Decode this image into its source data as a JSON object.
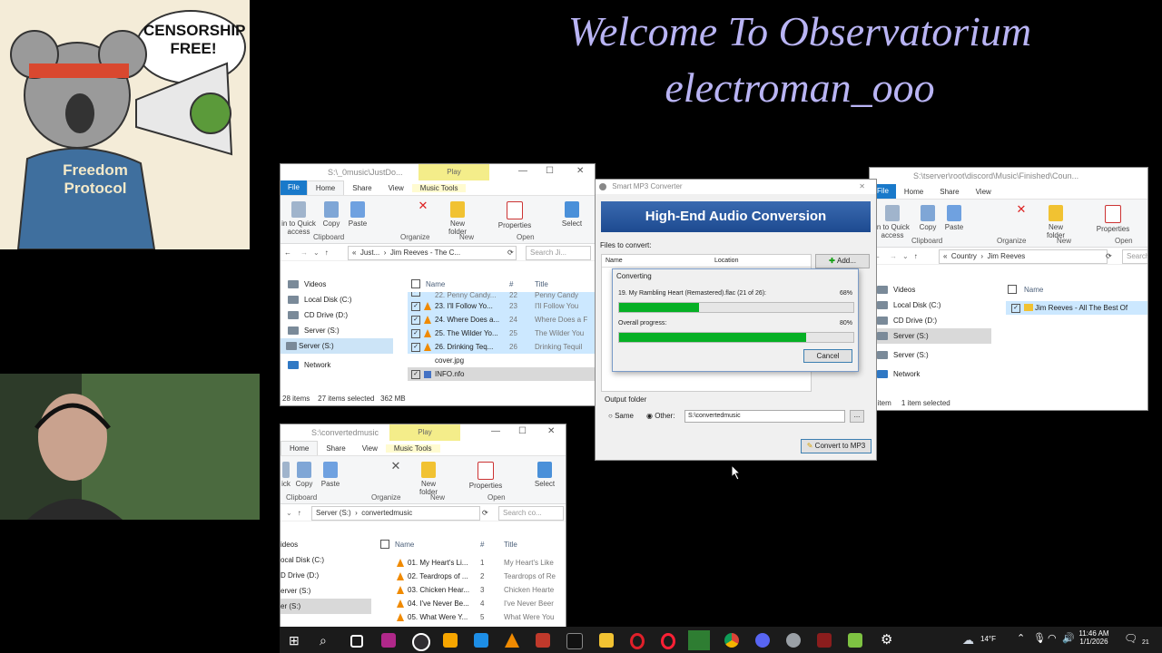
{
  "overlay": {
    "line1": "Welcome To Observatorium",
    "line2": "electroman_ooo"
  },
  "sticker": {
    "top_text": "CENSORSHIP\nFREE!",
    "hoodie_text": "Freedom Protocol"
  },
  "explorer1": {
    "path": "S:\\_0music\\JustDo...",
    "play_tab": "Play",
    "music_tools_tab": "Music Tools",
    "tabs": [
      "File",
      "Home",
      "Share",
      "View"
    ],
    "ribbon": {
      "pin": "in to Quick\naccess",
      "copy": "Copy",
      "paste": "Paste",
      "new_folder": "New\nfolder",
      "properties": "Properties",
      "select": "Select",
      "groups": [
        "Clipboard",
        "Organize",
        "New",
        "Open"
      ]
    },
    "address": [
      "«",
      "Just...",
      "›",
      "Jim Reeves - The C..."
    ],
    "search_placeholder": "Search Ji...",
    "nav": [
      "Videos",
      "Local Disk (C:)",
      "CD Drive (D:)",
      "Server (S:)",
      "Server (S:)",
      "Network"
    ],
    "columns": [
      "Name",
      "#",
      "Title"
    ],
    "rows": [
      {
        "name": "22. Penny Candy...",
        "num": "22",
        "title": "Penny Candy"
      },
      {
        "name": "23. I'll Follow Yo...",
        "num": "23",
        "title": "I'll Follow You"
      },
      {
        "name": "24. Where Does a...",
        "num": "24",
        "title": "Where Does a F"
      },
      {
        "name": "25. The Wilder Yo...",
        "num": "25",
        "title": "The Wilder You"
      },
      {
        "name": "26. Drinking Teq...",
        "num": "26",
        "title": "Drinking Tequil"
      },
      {
        "name": "cover.jpg",
        "num": "",
        "title": ""
      },
      {
        "name": "INFO.nfo",
        "num": "",
        "title": ""
      }
    ],
    "status": [
      "28 items",
      "27 items selected",
      "362 MB"
    ]
  },
  "explorer2": {
    "path": "S:\\convertedmusic",
    "play_tab": "Play",
    "music_tools_tab": "Music Tools",
    "tabs": [
      "Home",
      "Share",
      "View"
    ],
    "ribbon": {
      "pin": "ick",
      "copy": "Copy",
      "paste": "Paste",
      "new_folder": "New\nfolder",
      "properties": "Properties",
      "select": "Select",
      "groups": [
        "Clipboard",
        "Organize",
        "New",
        "Open"
      ]
    },
    "address": [
      "Server (S:)",
      "›",
      "convertedmusic"
    ],
    "search_placeholder": "Search co...",
    "nav": [
      "ideos",
      "ocal Disk (C:)",
      "D Drive (D:)",
      "erver (S:)",
      "er (S:)"
    ],
    "columns": [
      "Name",
      "#",
      "Title"
    ],
    "rows": [
      {
        "name": "01. My Heart's Li...",
        "num": "1",
        "title": "My Heart's Like"
      },
      {
        "name": "02. Teardrops of ...",
        "num": "2",
        "title": "Teardrops of Re"
      },
      {
        "name": "03. Chicken Hear...",
        "num": "3",
        "title": "Chicken Hearte"
      },
      {
        "name": "04. I've Never Be...",
        "num": "4",
        "title": "I've Never Beer"
      },
      {
        "name": "05. What Were Y...",
        "num": "5",
        "title": "What Were You"
      }
    ]
  },
  "explorer3": {
    "path": "S:\\tserver\\root\\discord\\Music\\Finished\\Coun...",
    "tabs": [
      "File",
      "Home",
      "Share",
      "View"
    ],
    "ribbon": {
      "pin": "in to Quick\naccess",
      "copy": "Copy",
      "paste": "Paste",
      "new_folder": "New\nfolder",
      "properties": "Properties",
      "groups": [
        "Clipboard",
        "Organize",
        "New",
        "Open"
      ]
    },
    "address": [
      "«",
      "Country",
      "›",
      "Jim Reeves"
    ],
    "search_placeholder": "Search",
    "nav": [
      "Videos",
      "Local Disk (C:)",
      "CD Drive (D:)",
      "Server (S:)",
      "Server (S:)",
      "Network"
    ],
    "columns": [
      "Name"
    ],
    "rows": [
      {
        "name": "Jim Reeves - All The Best Of"
      }
    ],
    "status": [
      "1 item",
      "1 item selected"
    ]
  },
  "converter": {
    "title": "Smart MP3 Converter",
    "banner": "High-End Audio Conversion",
    "files_label": "Files to convert:",
    "col_name": "Name",
    "col_location": "Location",
    "add_button": "Add...",
    "output_label": "Output folder",
    "radio_same": "Same",
    "radio_other": "Other:",
    "output_path": "S:\\convertedmusic",
    "browse": "...",
    "convert_button": "Convert to MP3",
    "dialog": {
      "title": "Converting",
      "file_line": "19. My Rambling Heart  (Remastered).flac (21 of 26):",
      "file_pct": "68%",
      "file_progress": 0.34,
      "overall_label": "Overall progress:",
      "overall_pct": "80%",
      "overall_progress": 0.8,
      "cancel": "Cancel"
    }
  },
  "taskbar": {
    "temp": "14°F",
    "time": "11:46 AM",
    "date": "1/1/2026",
    "notif": "21"
  }
}
